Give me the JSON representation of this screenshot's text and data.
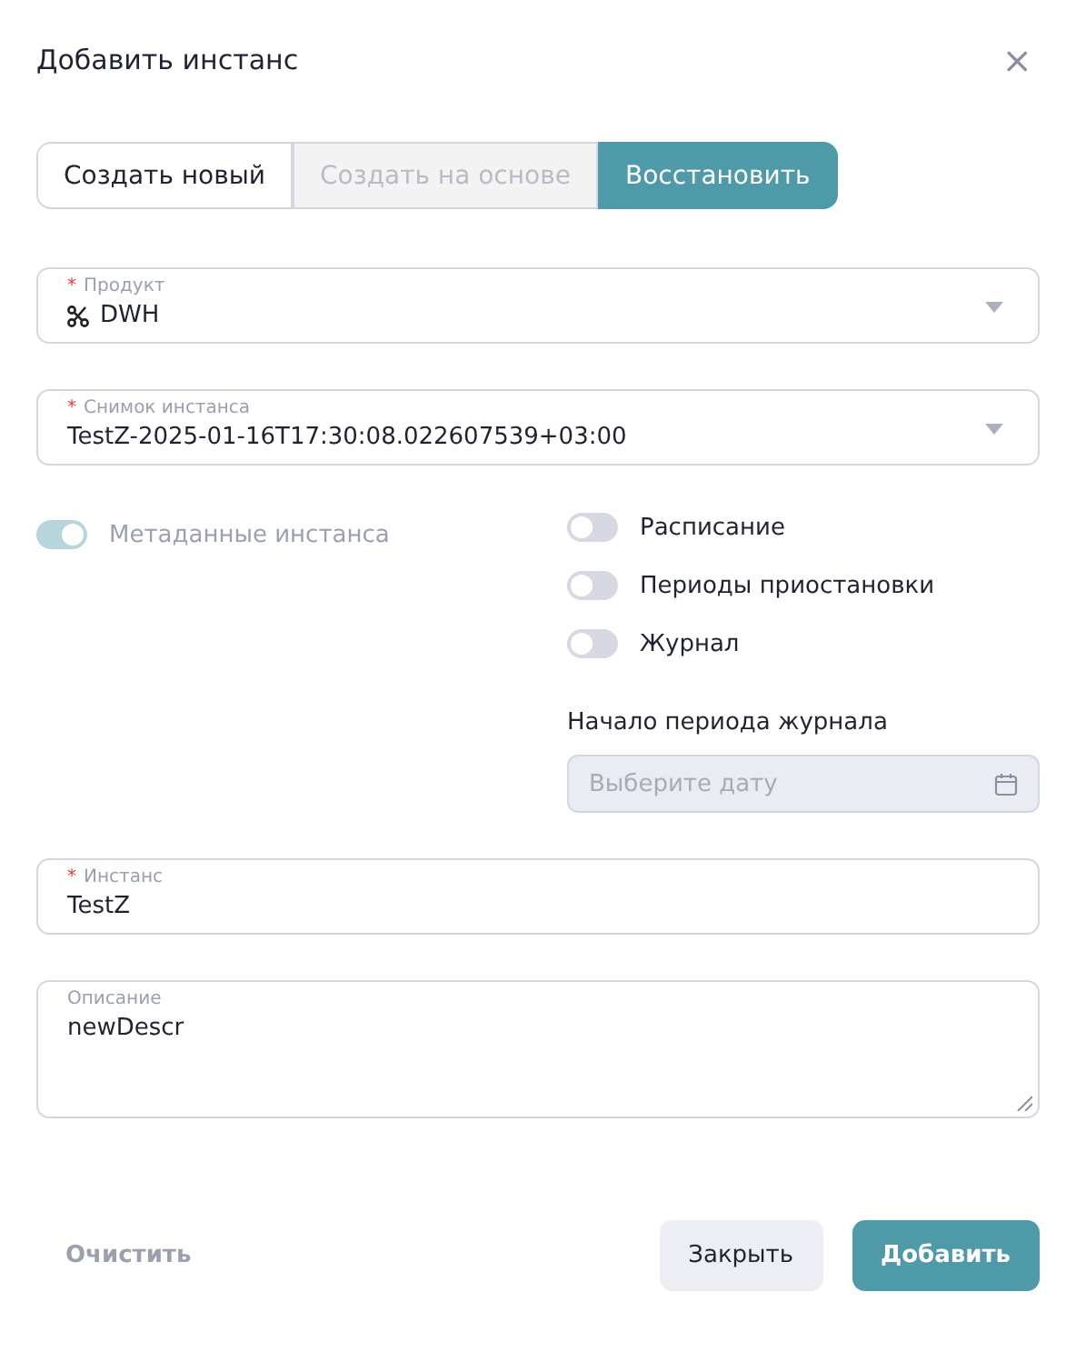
{
  "dialog": {
    "title": "Добавить инстанс",
    "close": "×"
  },
  "tabs": [
    {
      "label": "Создать новый",
      "selected": false,
      "disabled": false
    },
    {
      "label": "Создать на основе",
      "selected": false,
      "disabled": true
    },
    {
      "label": "Восстановить",
      "selected": true,
      "disabled": false
    }
  ],
  "product": {
    "mark": "*",
    "label": "Продукт",
    "value": "DWH"
  },
  "snapshot": {
    "mark": "*",
    "label": "Снимок инстанса",
    "value": "TestZ-2025-01-16T17:30:08.022607539+03:00"
  },
  "metadata_toggle": {
    "label": "Метаданные инстанса",
    "on": true,
    "disabled": true
  },
  "toggles": [
    {
      "label": "Расписание",
      "on": false
    },
    {
      "label": "Периоды приостановки",
      "on": false
    },
    {
      "label": "Журнал",
      "on": false
    }
  ],
  "log_start": {
    "label": "Начало периода журнала",
    "placeholder": "Выберите дату",
    "disabled": true
  },
  "instance": {
    "mark": "*",
    "label": "Инстанс",
    "value": "TestZ"
  },
  "description": {
    "label": "Описание",
    "value": "newDescr"
  },
  "buttons": {
    "clear": "Очистить",
    "close": "Закрыть",
    "add": "Добавить"
  }
}
